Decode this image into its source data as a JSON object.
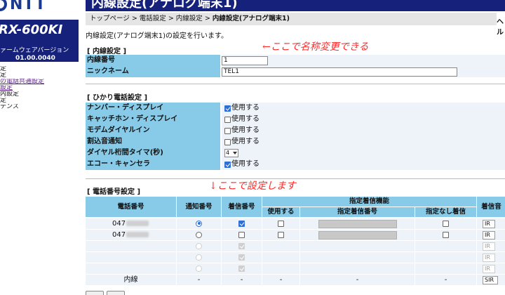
{
  "sidebar": {
    "logo_text": "NTT",
    "model_name": "RX-600KI",
    "firmware_label": "ァームウェアバージョン",
    "firmware_version": "01.00.0040",
    "menu": [
      "定",
      "定",
      "の電話共通設定",
      "設定",
      "内設定",
      "定",
      "テンス"
    ]
  },
  "header": {
    "title": "内線設定(アナログ端末1)",
    "help": "ヘル"
  },
  "breadcrumb": {
    "trail": "トップページ > 電話設定 > 内線設定 > ",
    "current": "内線設定(アナログ端末1)"
  },
  "description": "内線設定(アナログ端末1)の設定を行います。",
  "naisen": {
    "section_title": "[ 内線設定 ]",
    "number_label": "内線番号",
    "number_value": "1",
    "nickname_label": "ニックネーム",
    "nickname_value": "TEL1"
  },
  "hikari": {
    "section_title": "[ ひかり電話設定 ]",
    "rows": [
      {
        "label": "ナンバー・ディスプレイ",
        "option": "使用する",
        "checked": true
      },
      {
        "label": "キャッチホン・ディスプレイ",
        "option": "使用する",
        "checked": false
      },
      {
        "label": "モデムダイヤルイン",
        "option": "使用する",
        "checked": false
      },
      {
        "label": "割込音通知",
        "option": "使用する",
        "checked": false
      }
    ],
    "dial_timer_label": "ダイヤル桁間タイマ(秒)",
    "dial_timer_value": "4",
    "echo_label": "エコー・キャンセラ",
    "echo_option": "使用する",
    "echo_checked": true
  },
  "annotations": {
    "nickname_note": "←ここで名称変更できる",
    "phone_note": "↓ここで設定します"
  },
  "phone_table": {
    "section_title": "[ 電話番号設定 ]",
    "headers": {
      "number": "電話番号",
      "notify": "通知番号",
      "incoming": "着信番号",
      "designated_group": "指定着信機能",
      "use": "使用する",
      "designated_number": "指定着信番号",
      "no_designation": "指定なし着信",
      "ring": "着信音"
    },
    "rows": [
      {
        "number": "047",
        "notify": "on",
        "incoming": "on",
        "ring": "IR"
      },
      {
        "number": "047",
        "notify": "off",
        "incoming": "off",
        "ring": "IR"
      },
      {
        "number": "",
        "notify": "dis",
        "incoming": "dis",
        "ring": "IR"
      },
      {
        "number": "",
        "notify": "dis",
        "incoming": "dis",
        "ring": "IR"
      },
      {
        "number": "",
        "notify": "dis",
        "incoming": "dis",
        "ring": "IR"
      }
    ],
    "last_row": {
      "number": "内線",
      "notify": "-",
      "incoming": "-",
      "use": "-",
      "designated": "-",
      "nodesig": "-",
      "ring": "SIR"
    }
  }
}
